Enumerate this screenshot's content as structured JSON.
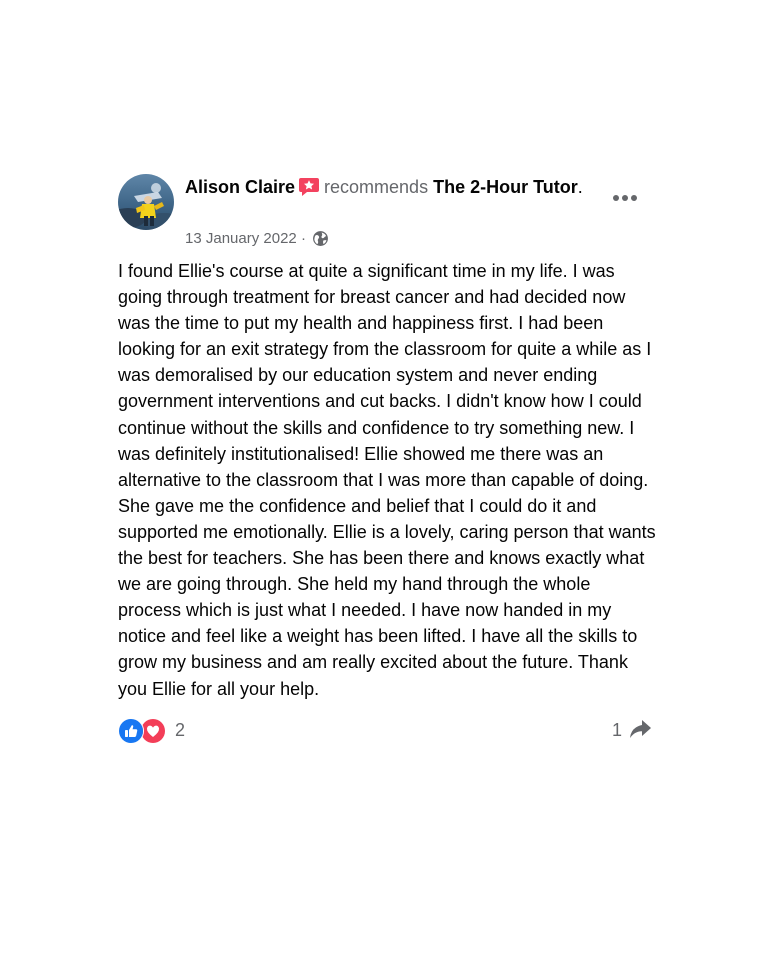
{
  "post": {
    "author": "Alison Claire",
    "recommends_word": "recommends",
    "page_name": "The 2-Hour Tutor",
    "period": ".",
    "date": "13 January 2022",
    "separator": "·",
    "audience_icon": "globe-icon",
    "badge_icon": "recommend-star-icon",
    "more_icon": "more-options-icon",
    "body": "I found Ellie's course at quite a significant time in my life. I was going through treatment for breast cancer and had decided now was the time to put my health and happiness first. I had been looking for an exit strategy from the classroom for quite a while as I was demoralised by our education system and never ending government interventions and cut backs. I didn't know how I could continue without the skills and confidence to try something new. I was definitely institutionalised! Ellie showed me there was an alternative to the classroom that I was more than capable of doing. She gave me the confidence and belief that I could do it and supported me emotionally. Ellie is a lovely, caring person that wants the best for teachers. She has been there and knows exactly what we are going through. She held my hand through the whole process which is just what I needed. I have now handed in my notice and feel like a weight has been lifted. I have all the skills to grow my business and am really excited about the future. Thank you Ellie for all your help."
  },
  "footer": {
    "reaction_icons": [
      "like-icon",
      "love-icon"
    ],
    "reaction_count": "2",
    "share_count": "1",
    "share_icon": "share-icon"
  },
  "colors": {
    "like_blue": "#1877f2",
    "love_red": "#f33e58",
    "badge_red": "#f3425f",
    "secondary_text": "#65676b",
    "primary_text": "#050505"
  }
}
